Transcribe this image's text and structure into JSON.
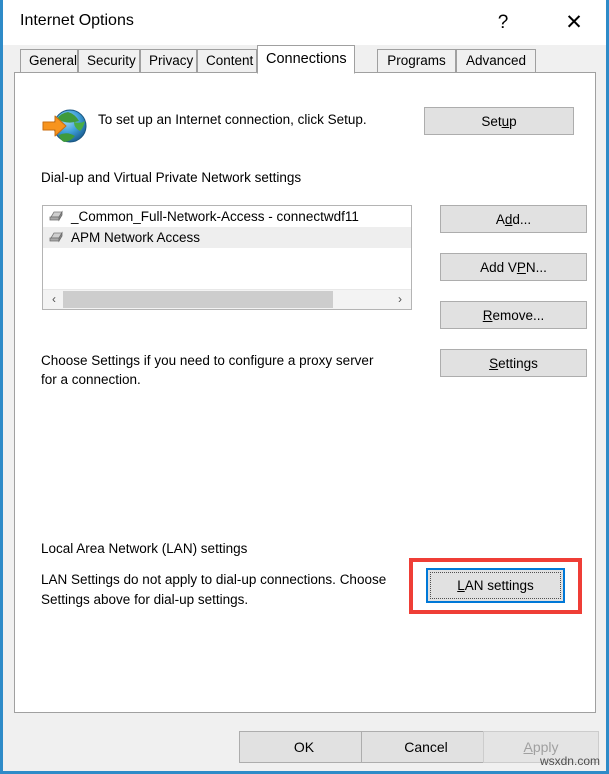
{
  "window": {
    "title": "Internet Options",
    "help_label": "?",
    "close_label": "✕"
  },
  "tabs": [
    {
      "label": "General",
      "active": false
    },
    {
      "label": "Security",
      "active": false
    },
    {
      "label": "Privacy",
      "active": false
    },
    {
      "label": "Content",
      "active": false
    },
    {
      "label": "Connections",
      "active": true
    },
    {
      "label": "Programs",
      "active": false
    },
    {
      "label": "Advanced",
      "active": false
    }
  ],
  "setup_section": {
    "description": "To set up an Internet connection, click Setup.",
    "button_label": "Setup",
    "button_accel_before": "Set",
    "button_accel_key": "u",
    "button_accel_after": "p",
    "icon": "globe-with-arrow-icon"
  },
  "dialup_section": {
    "group_label": "Dial-up and Virtual Private Network settings",
    "connections": [
      {
        "name": "_Common_Full-Network-Access - connectwdf11",
        "selected": false
      },
      {
        "name": "APM Network Access",
        "selected": true
      }
    ],
    "scrollbar": {
      "left_arrow": "‹",
      "right_arrow": "›"
    },
    "buttons": [
      {
        "id": "add",
        "label": "Add...",
        "before": "A",
        "accel": "d",
        "after": "d...",
        "disabled": false
      },
      {
        "id": "add_vpn",
        "label": "Add VPN...",
        "before": "Add V",
        "accel": "P",
        "after": "N...",
        "disabled": false
      },
      {
        "id": "remove",
        "label": "Remove...",
        "before": "",
        "accel": "R",
        "after": "emove...",
        "disabled": false
      },
      {
        "id": "settings",
        "label": "Settings",
        "before": "",
        "accel": "S",
        "after": "ettings",
        "disabled": false
      }
    ],
    "proxy_note": "Choose Settings if you need to configure a proxy server for a connection."
  },
  "lan_section": {
    "group_label": "Local Area Network (LAN) settings",
    "note": "LAN Settings do not apply to dial-up connections. Choose Settings above for dial-up settings.",
    "button": {
      "label": "LAN settings",
      "before": "",
      "accel": "L",
      "after": "AN settings",
      "focused": true,
      "highlighted": true
    }
  },
  "footer": {
    "ok_label": "OK",
    "cancel_label": "Cancel",
    "apply_before": "",
    "apply_accel": "A",
    "apply_after": "pply",
    "apply_disabled": true
  },
  "watermark": "wsxdn.com",
  "colors": {
    "window_border": "#2e8bc8",
    "highlight_red": "#ef3e36",
    "focus_blue": "#0078d7",
    "button_face": "#e1e1e1",
    "dialog_face": "#f0f0f0"
  }
}
